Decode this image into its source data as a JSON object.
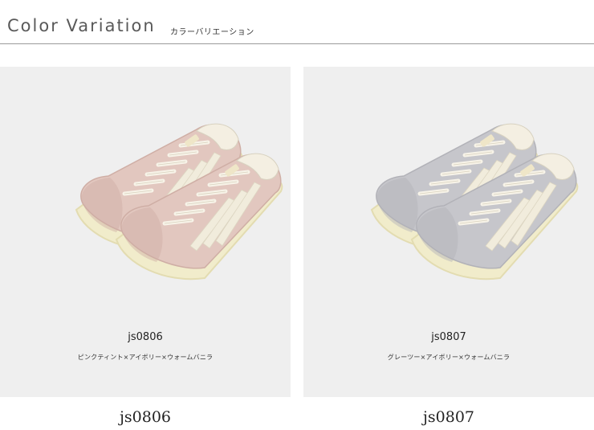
{
  "header": {
    "title": "Color Variation",
    "subtitle": "カラーバリエーション"
  },
  "products": [
    {
      "code": "js0806",
      "color_name": "ピンクティント×アイボリー×ウォームバニラ",
      "label": "js0806",
      "colors": {
        "suede": "#e2c7bf",
        "suede_dark": "#cfaea5",
        "stripe": "#f1ecdc",
        "sole": "#f1eccb",
        "sole_edge": "#e3dcb1",
        "collar": "#f4efe2"
      }
    },
    {
      "code": "js0807",
      "color_name": "グレーツー×アイボリー×ウォームバニラ",
      "label": "js0807",
      "colors": {
        "suede": "#c6c6cb",
        "suede_dark": "#b2b2b8",
        "stripe": "#f1ecdc",
        "sole": "#f1eccb",
        "sole_edge": "#e3dcb1",
        "collar": "#f4efe2"
      }
    }
  ]
}
